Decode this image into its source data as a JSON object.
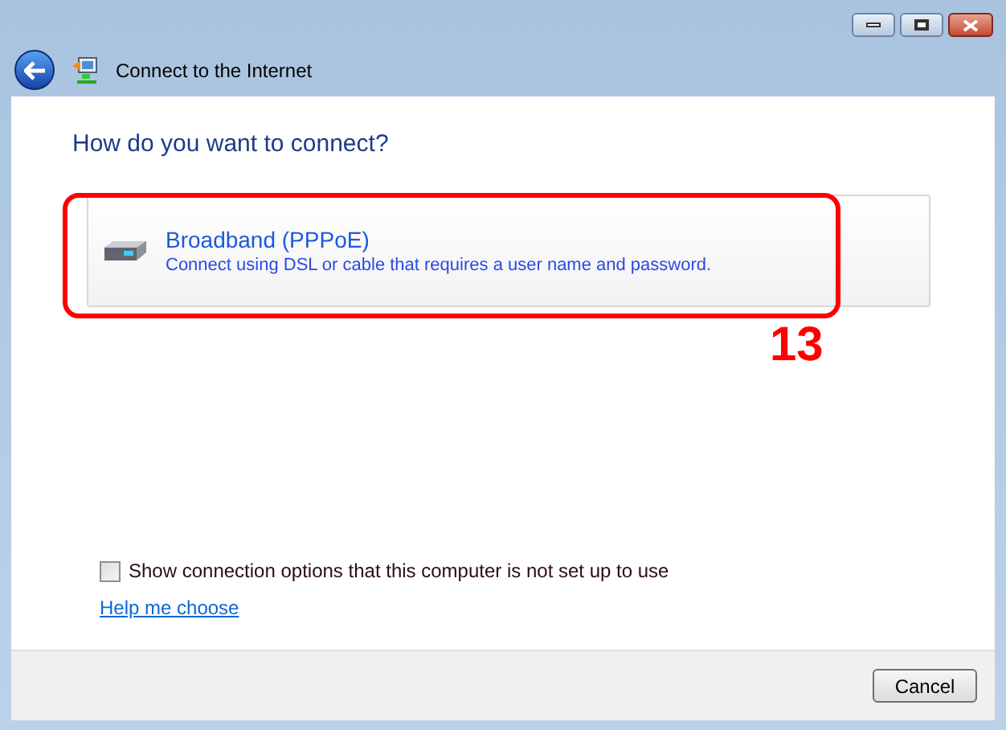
{
  "window": {
    "title": "Connect to the Internet"
  },
  "heading": "How do you want to connect?",
  "options": [
    {
      "title": "Broadband (PPPoE)",
      "description": "Connect using DSL or cable that requires a user name and password."
    }
  ],
  "annotation": {
    "label": "13"
  },
  "show_options": {
    "label": "Show connection options that this computer is not set up to use",
    "checked": false
  },
  "help_link": "Help me choose",
  "buttons": [
    "Cancel"
  ]
}
